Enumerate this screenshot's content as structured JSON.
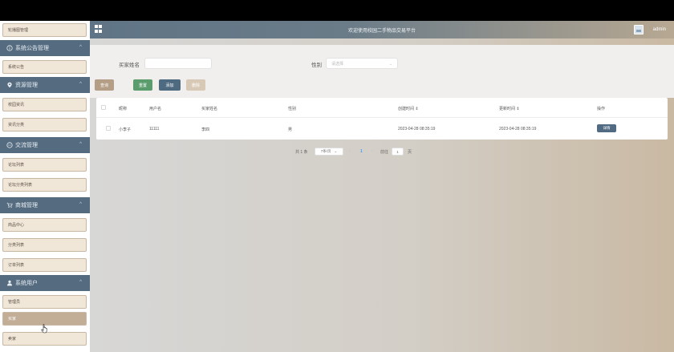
{
  "header": {
    "title": "欢迎使用校园二手物品交易平台",
    "username": "admin"
  },
  "sidebar": {
    "top_item": "轮播图管理",
    "groups": [
      {
        "label": "系统公告管理",
        "icon": "info-circle-icon",
        "items": [
          "系统公告"
        ]
      },
      {
        "label": "资源管理",
        "icon": "location-pin-icon",
        "items": [
          "校园资讯",
          "资讯分类"
        ]
      },
      {
        "label": "交流管理",
        "icon": "chat-bubble-icon",
        "items": [
          "论坛列表",
          "论坛分类列表"
        ]
      },
      {
        "label": "商城管理",
        "icon": "cart-icon",
        "items": [
          "商品中心",
          "分类列表",
          "订单列表"
        ]
      },
      {
        "label": "系统用户",
        "icon": "user-icon",
        "items": [
          "管理员",
          "买家",
          "卖家"
        ]
      }
    ],
    "active_item": "买家"
  },
  "search": {
    "name_label": "买家姓名",
    "name_value": "",
    "gender_label": "性别",
    "gender_placeholder": "请选择"
  },
  "buttons": {
    "query": "查询",
    "reset": "重置",
    "add": "添加",
    "delete": "删除"
  },
  "table": {
    "columns": [
      "昵称",
      "用户名",
      "买家姓名",
      "性别",
      "创建时间 ⇕",
      "更新时间 ⇕",
      "操作"
    ],
    "rows": [
      {
        "nickname": "小李子",
        "username": "11111",
        "name": "李四",
        "gender": "男",
        "created": "2023-04-28 08:35:19",
        "updated": "2023-04-28 08:35:19",
        "action": "详情"
      }
    ]
  },
  "pagination": {
    "total": "共 1 条",
    "page_size": "7条/页",
    "current_page": "1",
    "goto_label": "前往",
    "goto_value": "1",
    "page_unit": "页"
  },
  "colors": {
    "sidebar_group": "#546b80",
    "active_item": "#c2ad97",
    "query_button": "#b59e86",
    "reset_button": "#5b9c6d",
    "add_button": "#4e6a80",
    "delete_button": "#d8c9b6",
    "accent_page": "#409eff"
  }
}
